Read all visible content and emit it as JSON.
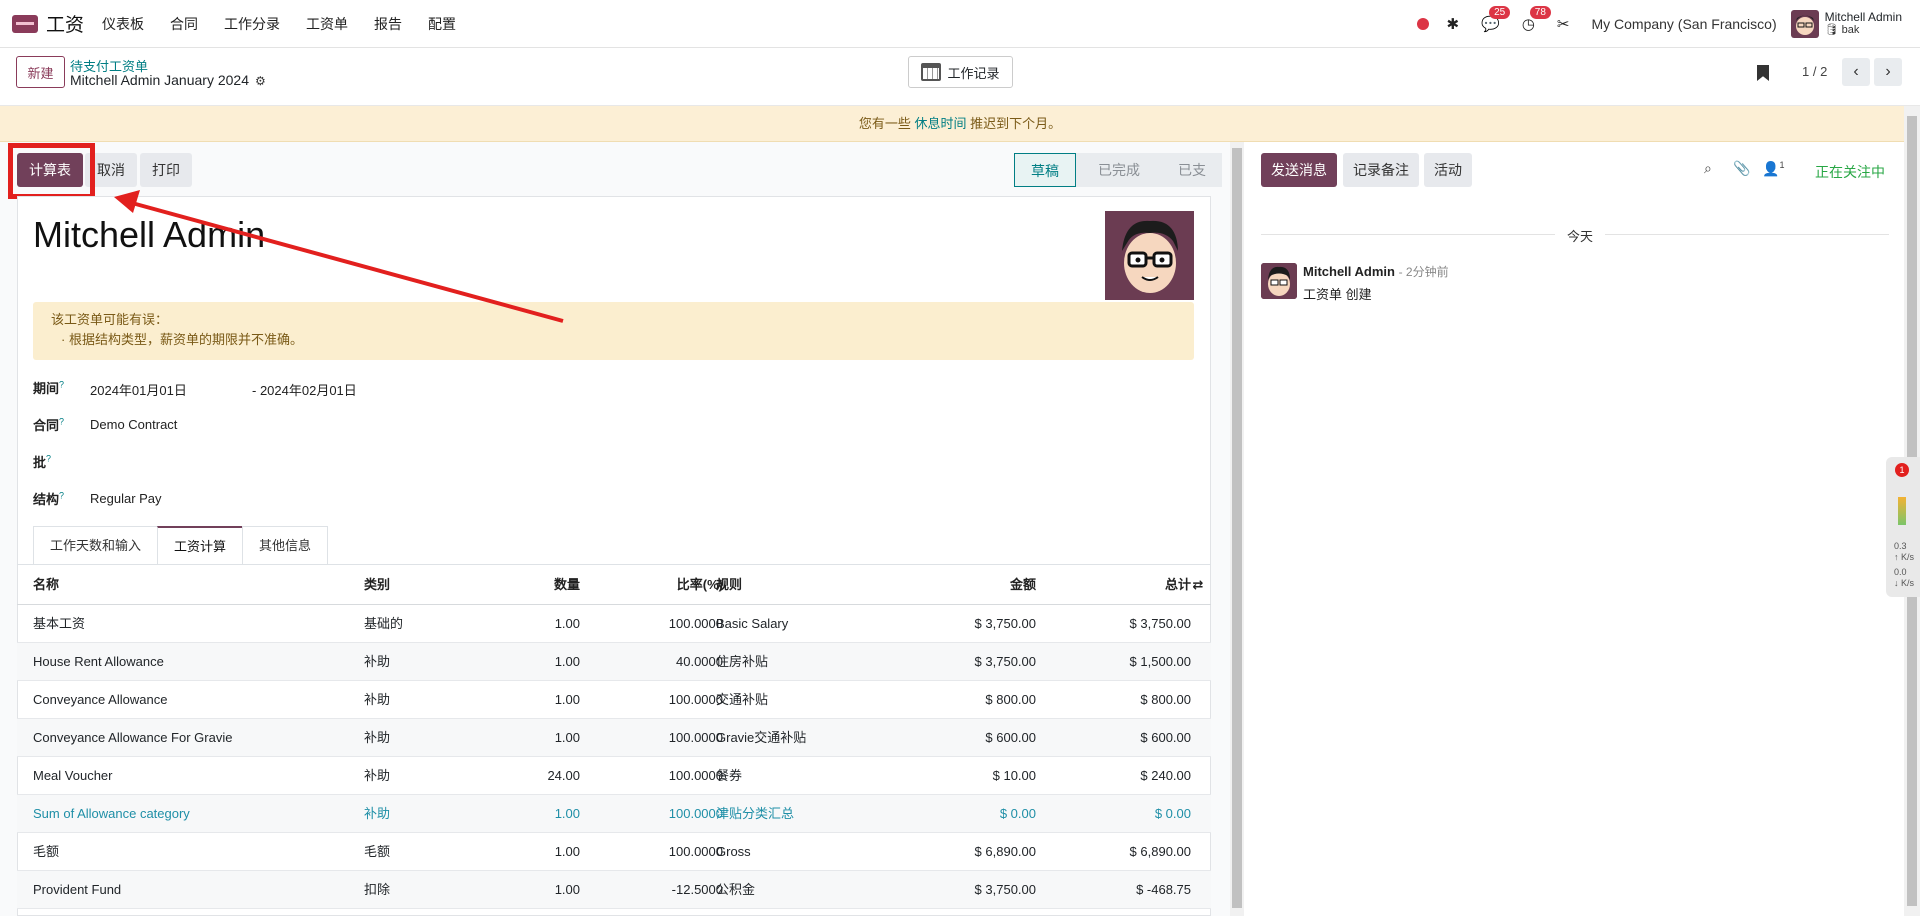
{
  "nav": {
    "app_name": "工资",
    "menu": [
      "仪表板",
      "合同",
      "工作分录",
      "工资单",
      "报告",
      "配置"
    ],
    "chat_badge": "25",
    "activity_badge": "78",
    "company": "My Company (San Francisco)",
    "user_name": "Mitchell Admin",
    "user_db": "bak"
  },
  "control": {
    "new_label": "新建",
    "breadcrumb": "待支付工资单",
    "record_name": "Mitchell Admin January 2024",
    "worklog_label": "工作记录",
    "pager": "1 / 2"
  },
  "banner": {
    "prefix": "您有一些",
    "link": "休息时间",
    "suffix": "推迟到下个月。"
  },
  "actions": {
    "compute": "计算表",
    "cancel": "取消",
    "print": "打印"
  },
  "states": [
    "草稿",
    "已完成",
    "已支"
  ],
  "form": {
    "employee": "Mitchell Admin",
    "warning_title": "该工资单可能有误：",
    "warning_item": "· 根据结构类型，薪资单的期限并不准确。",
    "period_label": "期间",
    "period_from": "2024年01月01日",
    "period_to": "- 2024年02月01日",
    "contract_label": "合同",
    "contract_value": "Demo Contract",
    "batch_label": "批",
    "structure_label": "结构",
    "structure_value": "Regular Pay",
    "help_mark": "?"
  },
  "tabs": [
    "工作天数和输入",
    "工资计算",
    "其他信息"
  ],
  "table": {
    "headers": [
      "名称",
      "类别",
      "数量",
      "比率(%)",
      "规则",
      "金额",
      "总计"
    ],
    "rows": [
      {
        "name": "基本工资",
        "cat": "基础的",
        "qty": "1.00",
        "rate": "100.0000",
        "rule": "Basic Salary",
        "amount": "$ 3,750.00",
        "total": "$ 3,750.00"
      },
      {
        "name": "House Rent Allowance",
        "cat": "补助",
        "qty": "1.00",
        "rate": "40.0000",
        "rule": "住房补贴",
        "amount": "$ 3,750.00",
        "total": "$ 1,500.00"
      },
      {
        "name": "Conveyance Allowance",
        "cat": "补助",
        "qty": "1.00",
        "rate": "100.0000",
        "rule": "交通补贴",
        "amount": "$ 800.00",
        "total": "$ 800.00"
      },
      {
        "name": "Conveyance Allowance For Gravie",
        "cat": "补助",
        "qty": "1.00",
        "rate": "100.0000",
        "rule": "Gravie交通补贴",
        "amount": "$ 600.00",
        "total": "$ 600.00"
      },
      {
        "name": "Meal Voucher",
        "cat": "补助",
        "qty": "24.00",
        "rate": "100.0000",
        "rule": "餐券",
        "amount": "$ 10.00",
        "total": "$ 240.00"
      },
      {
        "name": "Sum of Allowance category",
        "cat": "补助",
        "qty": "1.00",
        "rate": "100.0000",
        "rule": "津贴分类汇总",
        "amount": "$ 0.00",
        "total": "$ 0.00"
      },
      {
        "name": "毛额",
        "cat": "毛额",
        "qty": "1.00",
        "rate": "100.0000",
        "rule": "Gross",
        "amount": "$ 6,890.00",
        "total": "$ 6,890.00"
      },
      {
        "name": "Provident Fund",
        "cat": "扣除",
        "qty": "1.00",
        "rate": "-12.5000",
        "rule": "公积金",
        "amount": "$ 3,750.00",
        "total": "$ -468.75"
      }
    ]
  },
  "chatter": {
    "send": "发送消息",
    "note": "记录备注",
    "activity": "活动",
    "followers": "1",
    "following": "正在关注中",
    "today": "今天",
    "author": "Mitchell Admin",
    "time": "- 2分钟前",
    "body": "工资单 创建"
  },
  "widget": {
    "badge": "1",
    "up": "0.3",
    "down": "0.0",
    "unit": "K/s"
  }
}
